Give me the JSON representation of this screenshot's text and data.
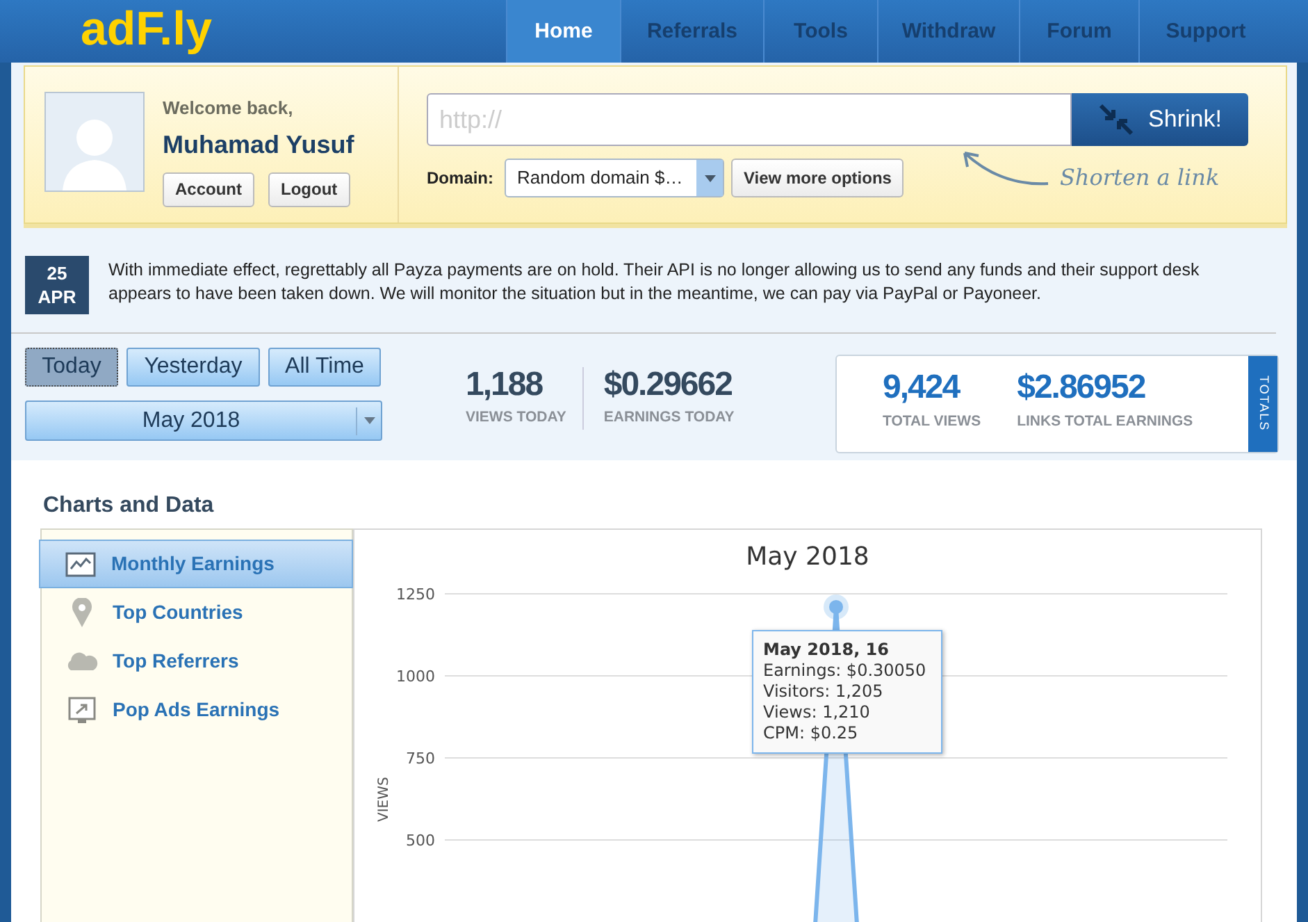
{
  "header": {
    "logo": "adF.ly",
    "nav": [
      {
        "label": "Home",
        "selected": true
      },
      {
        "label": "Referrals",
        "selected": false
      },
      {
        "label": "Tools",
        "selected": false
      },
      {
        "label": "Withdraw",
        "selected": false
      },
      {
        "label": "Forum",
        "selected": false
      },
      {
        "label": "Support",
        "selected": false
      }
    ]
  },
  "user": {
    "greeting": "Welcome back,",
    "name": "Muhamad Yusuf",
    "buttons": [
      "Account",
      "Logout"
    ]
  },
  "shrink": {
    "placeholder": "http://",
    "button": "Shrink!",
    "domain_label": "Domain:",
    "domain_value": "Random domain $…",
    "more_button": "View more options",
    "hint": "Shorten a link"
  },
  "news": {
    "day": "25",
    "month": "APR",
    "text": "With immediate effect, regrettably all Payza payments are on hold. Their API is no longer allowing us to send any funds and their support desk appears to have been taken down. We will monitor the situation but in the meantime, we can pay via PayPal or Payoneer."
  },
  "periods": [
    {
      "label": "Today",
      "selected": true
    },
    {
      "label": "Yesterday",
      "selected": false
    },
    {
      "label": "All Time",
      "selected": false
    }
  ],
  "month_select": "May 2018",
  "stats_today": [
    {
      "value": "1,188",
      "label": "VIEWS TODAY"
    },
    {
      "value": "$0.29662",
      "label": "EARNINGS TODAY"
    }
  ],
  "totals": {
    "items": [
      {
        "value": "9,424",
        "label": "TOTAL VIEWS"
      },
      {
        "value": "$2.86952",
        "label": "LINKS TOTAL EARNINGS"
      }
    ],
    "tab": "TOTALS"
  },
  "charts_section": {
    "title": "Charts and Data",
    "menu": [
      {
        "label": "Monthly Earnings",
        "kind": "chart",
        "selected": true
      },
      {
        "label": "Top Countries",
        "kind": "pin",
        "selected": false
      },
      {
        "label": "Top Referrers",
        "kind": "cloud",
        "selected": false
      },
      {
        "label": "Pop Ads Earnings",
        "kind": "screen",
        "selected": false
      }
    ],
    "chart_data": {
      "type": "area",
      "title": "May 2018",
      "ylabel": "VIEWS",
      "series": [
        {
          "color": "#7cb5ec",
          "values": [
            0,
            0,
            0,
            0,
            0,
            0,
            0,
            0,
            0,
            0,
            0,
            0,
            0,
            0,
            0,
            1210,
            0,
            0,
            0,
            0,
            0,
            0,
            0,
            0,
            0,
            0,
            0,
            0,
            0,
            0,
            0
          ]
        }
      ],
      "ylim": [
        0,
        1250
      ],
      "yticks": [
        500,
        750,
        1000,
        1250
      ],
      "grid": true
    },
    "tooltip": {
      "title": "May 2018, 16",
      "lines": [
        "Earnings: $0.30050",
        "Visitors: 1,205",
        "Views: 1,210",
        "CPM: $0.25"
      ]
    }
  }
}
